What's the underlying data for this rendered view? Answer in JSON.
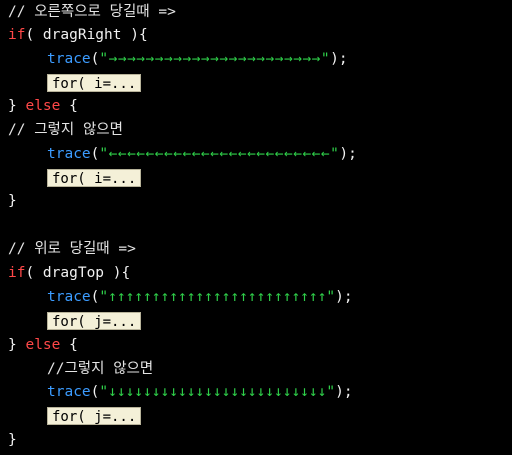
{
  "colors": {
    "background": "#000000",
    "keyword": "#ff4848",
    "function": "#3c9cff",
    "string": "#2fd04a",
    "text": "#f2f2f2",
    "fold_background": "#f4f0d8"
  },
  "code": {
    "comment_drag_right": "// 오른쪽으로 당길때 =>",
    "if_keyword": "if",
    "if1_cond": "( dragRight ){",
    "trace_fn": "trace",
    "paren_open": "(",
    "trace_end": ");",
    "str_right_arrows": "\"→→→→→→→→→→→→→→→→→→→→→→→\"",
    "fold_for_i": "for( i=...",
    "close_brace": "}",
    "else_keyword": "else",
    "open_brace": "{",
    "comment_otherwise": "// 그렇지 않으면",
    "str_left_arrows": "\"←←←←←←←←←←←←←←←←←←←←←←←←\"",
    "comment_drag_top": "// 위로 당길때 =>",
    "if2_cond": "( dragTop ){",
    "str_up_arrows": "\"↑↑↑↑↑↑↑↑↑↑↑↑↑↑↑↑↑↑↑↑↑↑↑↑↑\"",
    "fold_for_j": "for( j=...",
    "comment_otherwise_2": "//그렇지 않으면",
    "str_down_arrows": "\"↓↓↓↓↓↓↓↓↓↓↓↓↓↓↓↓↓↓↓↓↓↓↓↓↓\""
  }
}
